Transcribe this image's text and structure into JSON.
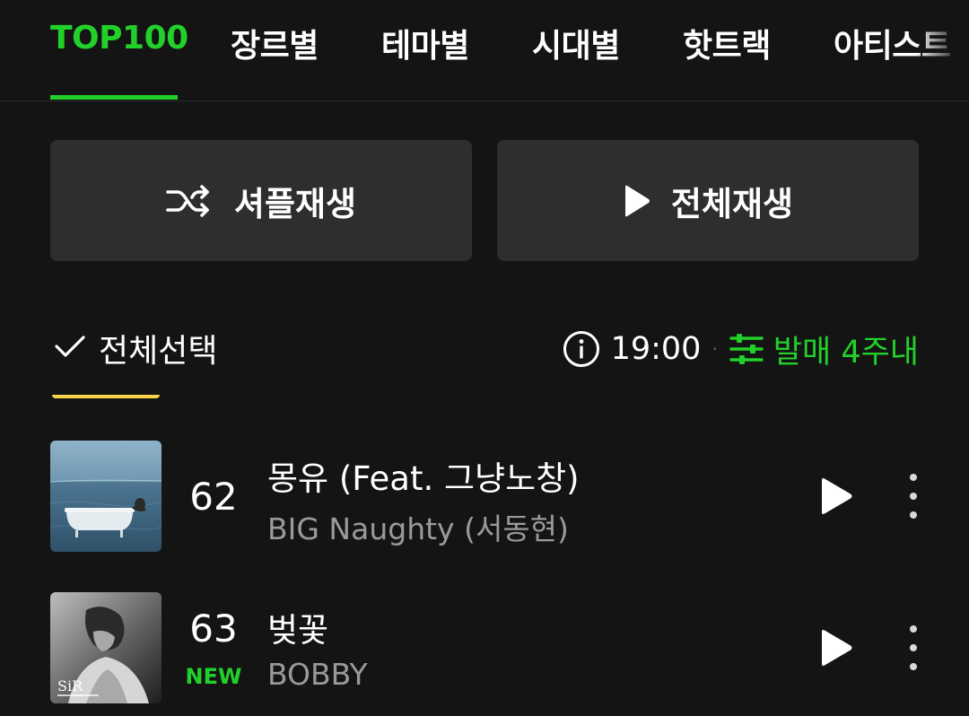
{
  "tabs": [
    {
      "label": "TOP100",
      "active": true
    },
    {
      "label": "장르별",
      "active": false
    },
    {
      "label": "테마별",
      "active": false
    },
    {
      "label": "시대별",
      "active": false
    },
    {
      "label": "핫트랙",
      "active": false
    },
    {
      "label": "아티스트",
      "active": false
    }
  ],
  "actions": {
    "shuffle_label": "셔플재생",
    "shuffle_icon": "shuffle-icon",
    "play_all_label": "전체재생",
    "play_all_icon": "play-icon"
  },
  "list_header": {
    "select_all_label": "전체선택",
    "select_icon": "check-icon",
    "info_icon": "info-icon",
    "update_time": "19:00",
    "separator": "·",
    "filter_icon": "sliders-icon",
    "filter_label": "발매 4주내"
  },
  "songs": [
    {
      "rank": "62",
      "badge": "",
      "title": "몽유 (Feat. 그냥노창)",
      "artist": "BIG Naughty (서동현)",
      "art": "bathtub-by-the-sea-cover"
    },
    {
      "rank": "63",
      "badge": "NEW",
      "title": "벚꽃",
      "artist": "BOBBY",
      "art": "sir-bw-portrait-cover"
    }
  ],
  "colors": {
    "background": "#141414",
    "accent": "#21d12a",
    "button_bg": "#2e2e2e",
    "artist_text": "#9a9a9a",
    "highlight": "#f5d24a"
  }
}
